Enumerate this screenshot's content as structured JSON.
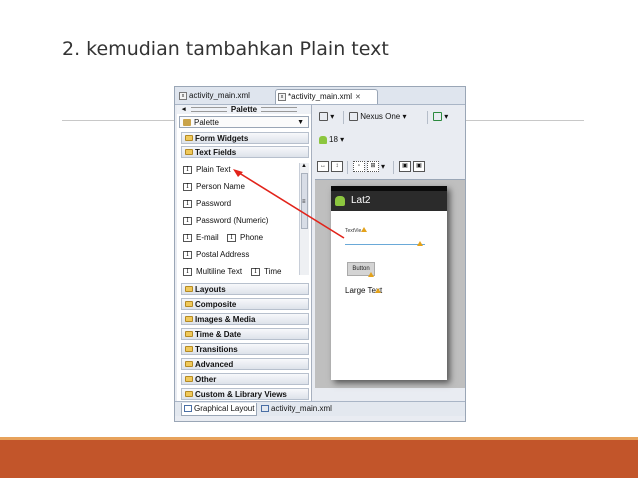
{
  "slide": {
    "title": "2. kemudian tambahkan Plain text"
  },
  "editor_tabs": [
    {
      "label": "activity_main.xml"
    },
    {
      "label": "*activity_main.xml"
    }
  ],
  "palette": {
    "header": "Palette",
    "selector": "Palette",
    "categories": {
      "form_widgets": "Form Widgets",
      "text_fields": "Text Fields",
      "layouts": "Layouts",
      "composite": "Composite",
      "images_media": "Images & Media",
      "time_date": "Time & Date",
      "transitions": "Transitions",
      "advanced": "Advanced",
      "other": "Other",
      "custom_library": "Custom & Library Views"
    },
    "text_field_items": {
      "plain_text": "Plain Text",
      "person_name": "Person Name",
      "password": "Password",
      "password_numeric": "Password (Numeric)",
      "email": "E-mail",
      "phone": "Phone",
      "postal_address": "Postal Address",
      "multiline_text": "Multiline Text",
      "time": "Time"
    }
  },
  "toolbar": {
    "device": "Nexus One",
    "api_level": "18"
  },
  "preview": {
    "app_title": "Lat2",
    "text_field_hint": "TextVie",
    "button_label": "Button",
    "large_text": "Large Text"
  },
  "bottom_tabs": {
    "graphical_layout": "Graphical Layout",
    "xml": "activity_main.xml"
  },
  "colors": {
    "footer": "#c2552a",
    "footer_accent": "#e7a25b",
    "arrow": "#e2231a"
  }
}
